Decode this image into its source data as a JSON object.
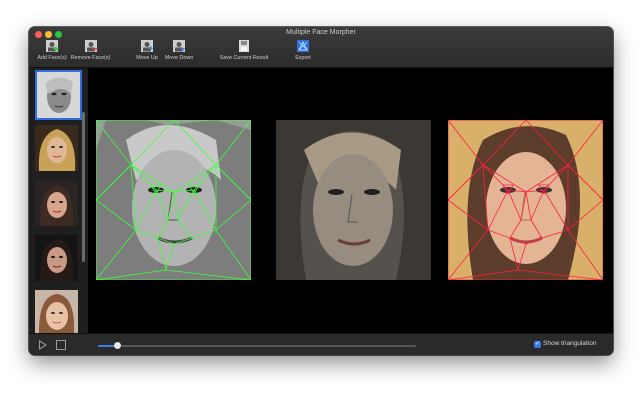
{
  "window": {
    "title": "Multiple Face Morpher"
  },
  "toolbar": {
    "add_label": "Add Face(s)",
    "remove_label": "Remove Face(s)",
    "move_up_label": "Move Up",
    "move_down_label": "Move Down",
    "save_label": "Save Current Result",
    "export_label": "Export"
  },
  "bottom": {
    "triangulation_label": "Show triangulation",
    "triangulation_checked": true,
    "morph_progress": 0.06
  },
  "colors": {
    "accent": "#2f6fe0",
    "source_mesh": "#3cff3c",
    "target_mesh": "#ff2040"
  },
  "icons": {
    "play": "play-icon",
    "stop": "stop-icon",
    "checkbox": "checkmark-icon"
  }
}
